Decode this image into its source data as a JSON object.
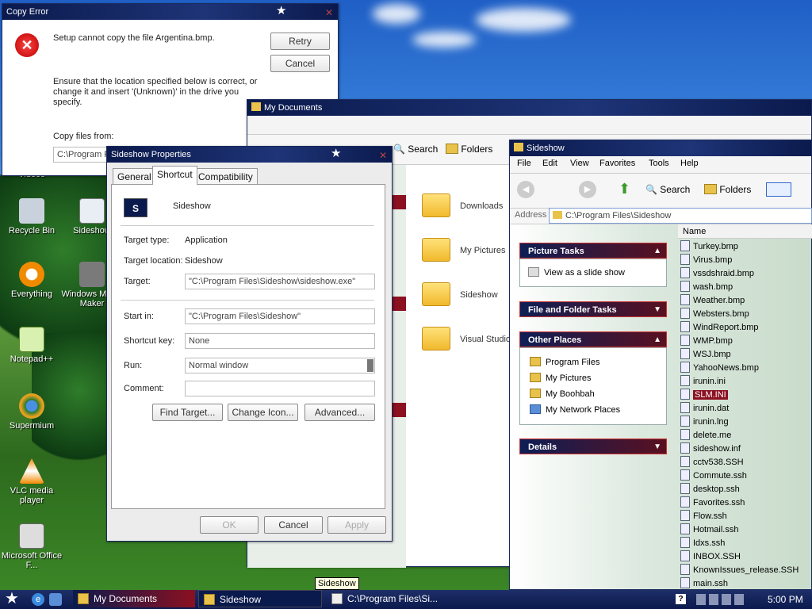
{
  "desktop": {
    "icons": [
      {
        "label": "Videos"
      },
      {
        "label": "Recycle Bin"
      },
      {
        "label": "Sideshow"
      },
      {
        "label": "Everything"
      },
      {
        "label": "Windows Movie Maker"
      },
      {
        "label": "Notepad++"
      },
      {
        "label": "Supermium"
      },
      {
        "label": "VLC media player"
      },
      {
        "label": "Microsoft Office F..."
      }
    ]
  },
  "copy_error": {
    "title": "Copy Error",
    "message": "Setup cannot copy the file Argentina.bmp.",
    "detail": "Ensure that the location specified below is correct, or change it and insert '(Unknown)' in the drive you specify.",
    "copy_from_label": "Copy files from:",
    "copy_from_value": "C:\\Program Files",
    "retry": "Retry",
    "cancel": "Cancel"
  },
  "properties": {
    "title": "Sideshow Properties",
    "tabs": [
      "General",
      "Shortcut",
      "Compatibility"
    ],
    "name": "Sideshow",
    "target_type_label": "Target type:",
    "target_type": "Application",
    "target_location_label": "Target location:",
    "target_location": "Sideshow",
    "target_label": "Target:",
    "target": "\"C:\\Program Files\\Sideshow\\sideshow.exe\"",
    "start_in_label": "Start in:",
    "start_in": "\"C:\\Program Files\\Sideshow\"",
    "shortcut_key_label": "Shortcut key:",
    "shortcut_key": "None",
    "run_label": "Run:",
    "run": "Normal window",
    "comment_label": "Comment:",
    "comment": "",
    "find_target": "Find Target...",
    "change_icon": "Change Icon...",
    "advanced": "Advanced...",
    "ok": "OK",
    "cancel": "Cancel",
    "apply": "Apply"
  },
  "my_documents": {
    "title": "My Documents",
    "search": "Search",
    "folders": "Folders",
    "items": [
      "Downloads",
      "My Pictures",
      "Sideshow",
      "Visual Studio"
    ]
  },
  "sideshow": {
    "title": "Sideshow",
    "menu": [
      "File",
      "Edit",
      "View",
      "Favorites",
      "Tools",
      "Help"
    ],
    "search": "Search",
    "folders": "Folders",
    "address_label": "Address",
    "address": "C:\\Program Files\\Sideshow",
    "column_name": "Name",
    "picture_tasks": "Picture Tasks",
    "view_slideshow": "View as a slide show",
    "file_folder_tasks": "File and Folder Tasks",
    "other_places": "Other Places",
    "places": [
      "Program Files",
      "My Pictures",
      "My Boohbah",
      "My Network Places"
    ],
    "details": "Details",
    "files": [
      "Turkey.bmp",
      "Virus.bmp",
      "vssdshraid.bmp",
      "wash.bmp",
      "Weather.bmp",
      "Websters.bmp",
      "WindReport.bmp",
      "WMP.bmp",
      "WSJ.bmp",
      "YahooNews.bmp",
      "irunin.ini",
      "SLM.INI",
      "irunin.dat",
      "irunin.lng",
      "delete.me",
      "sideshow.inf",
      "cctv538.SSH",
      "Commute.ssh",
      "desktop.ssh",
      "Favorites.ssh",
      "Flow.ssh",
      "Hotmail.ssh",
      "Idxs.ssh",
      "INBOX.SSH",
      "KnownIssues_release.SSH",
      "main.ssh"
    ],
    "selected_file": "SLM.INI"
  },
  "taskbar": {
    "tasks": [
      "My Documents",
      "Sideshow",
      "C:\\Program Files\\Si..."
    ],
    "tooltip": "Sideshow",
    "clock": "5:00 PM"
  },
  "colors": {
    "title_blue": "#0b1a4d",
    "accent_red": "#8b1020"
  }
}
